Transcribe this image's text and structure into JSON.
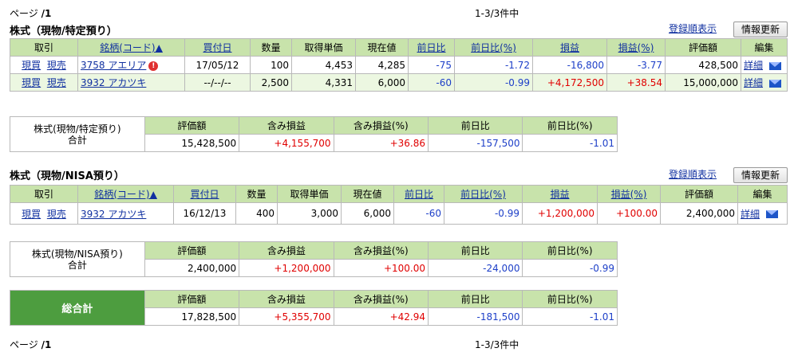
{
  "pager": {
    "page_label": "ページ",
    "page_num": "/1",
    "count": "1-3/3件中"
  },
  "section1": {
    "title": "株式（現物/特定預り）",
    "sort_link": "登録順表示",
    "refresh_button": "情報更新",
    "headers": [
      "取引",
      "銘柄(コード)▲",
      "買付日",
      "数量",
      "取得単価",
      "現在値",
      "前日比",
      "前日比(%)",
      "損益",
      "損益(%)",
      "評価額",
      "編集"
    ],
    "rows": [
      {
        "buy": "現買",
        "sell": "現売",
        "stock": "3758 アエリア",
        "alert": "!",
        "date": "17/05/12",
        "qty": "100",
        "cost": "4,453",
        "price": "4,285",
        "chg": "-75",
        "chg_pct": "-1.72",
        "pl": "-16,800",
        "pl_pct": "-3.77",
        "value": "428,500",
        "detail": "詳細"
      },
      {
        "buy": "現買",
        "sell": "現売",
        "stock": "3932 アカツキ",
        "date": "--/--/--",
        "qty": "2,500",
        "cost": "4,331",
        "price": "6,000",
        "chg": "-60",
        "chg_pct": "-0.99",
        "pl": "+4,172,500",
        "pl_pct": "+38.54",
        "value": "15,000,000",
        "detail": "詳細"
      }
    ],
    "summary": {
      "label1": "株式(現物/特定預り)",
      "label2": "合計",
      "headers": [
        "評価額",
        "含み損益",
        "含み損益(%)",
        "前日比",
        "前日比(%)"
      ],
      "values": [
        "15,428,500",
        "+4,155,700",
        "+36.86",
        "-157,500",
        "-1.01"
      ]
    }
  },
  "section2": {
    "title": "株式（現物/NISA預り）",
    "sort_link": "登録順表示",
    "refresh_button": "情報更新",
    "headers": [
      "取引",
      "銘柄(コード)▲",
      "買付日",
      "数量",
      "取得単価",
      "現在値",
      "前日比",
      "前日比(%)",
      "損益",
      "損益(%)",
      "評価額",
      "編集"
    ],
    "rows": [
      {
        "buy": "現買",
        "sell": "現売",
        "stock": "3932 アカツキ",
        "date": "16/12/13",
        "qty": "400",
        "cost": "3,000",
        "price": "6,000",
        "chg": "-60",
        "chg_pct": "-0.99",
        "pl": "+1,200,000",
        "pl_pct": "+100.00",
        "value": "2,400,000",
        "detail": "詳細"
      }
    ],
    "summary": {
      "label1": "株式(現物/NISA預り)",
      "label2": "合計",
      "headers": [
        "評価額",
        "含み損益",
        "含み損益(%)",
        "前日比",
        "前日比(%)"
      ],
      "values": [
        "2,400,000",
        "+1,200,000",
        "+100.00",
        "-24,000",
        "-0.99"
      ]
    }
  },
  "grand": {
    "label": "総合計",
    "headers": [
      "評価額",
      "含み損益",
      "含み損益(%)",
      "前日比",
      "前日比(%)"
    ],
    "values": [
      "17,828,500",
      "+5,355,700",
      "+42.94",
      "-181,500",
      "-1.01"
    ]
  },
  "colors": {
    "header_bg": "#c8e3ab",
    "row_alt": "#ecf7e1",
    "grand_bg": "#4d9d3f",
    "neg": "#1d3fc8",
    "pos": "#e00000",
    "link": "#1030a0"
  },
  "icons": {
    "alert": "exclamation-circle-icon",
    "mail": "envelope-icon"
  }
}
